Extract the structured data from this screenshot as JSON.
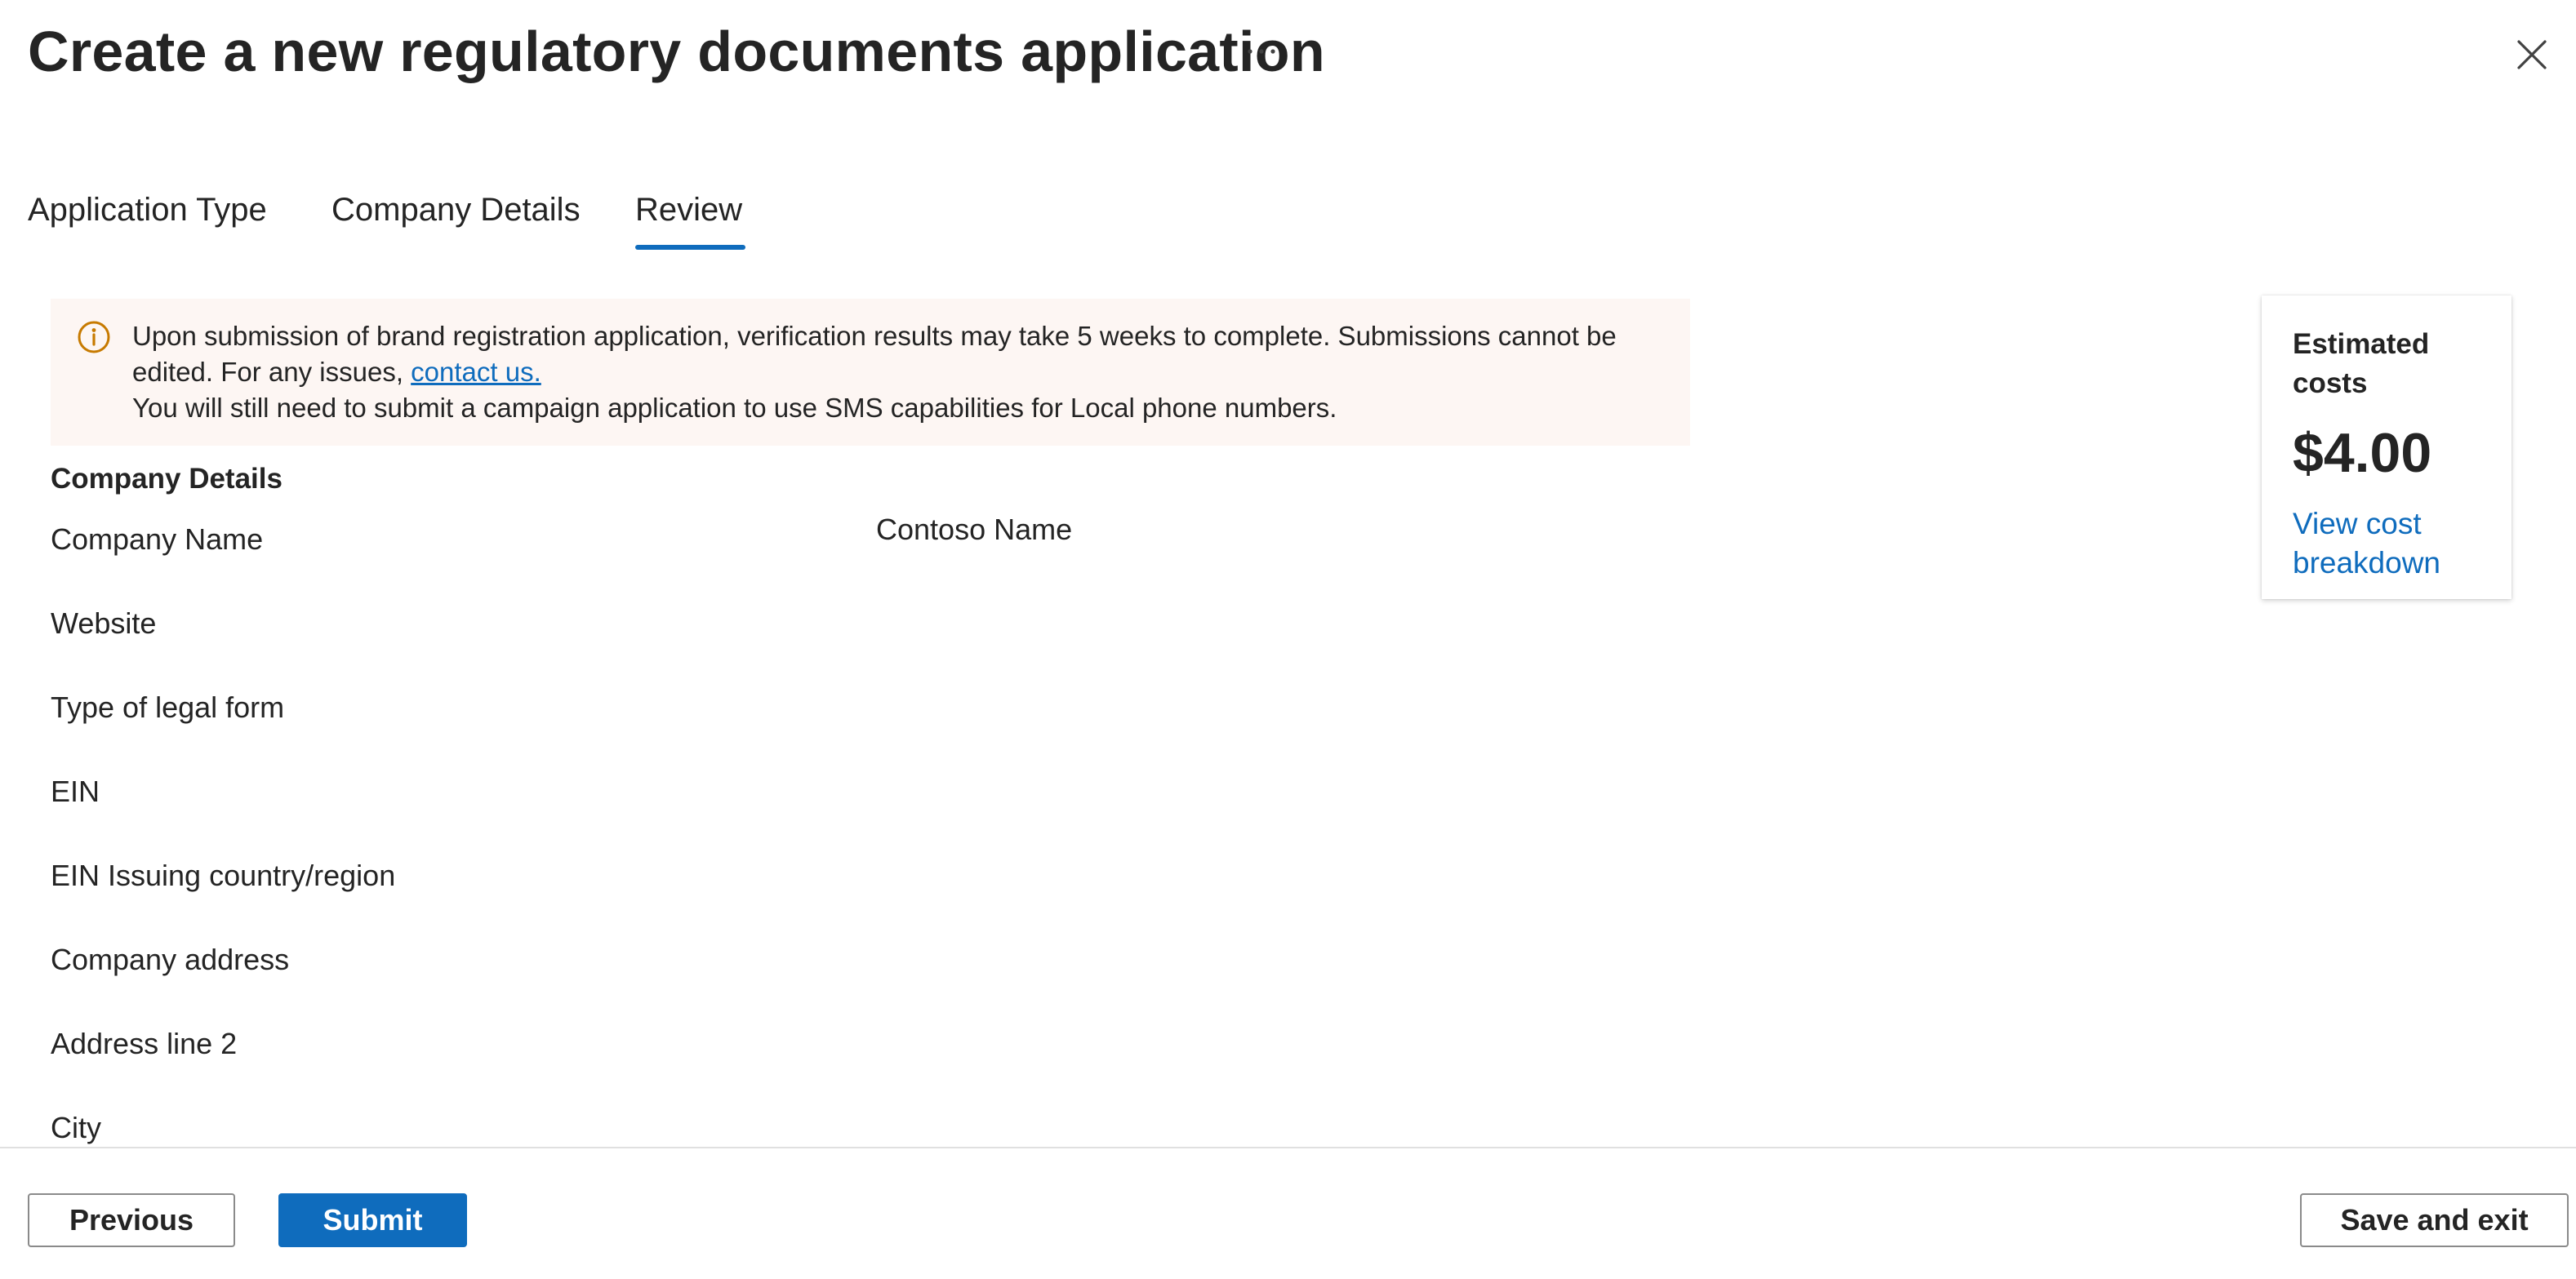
{
  "header": {
    "title": "Create a new regulatory documents application",
    "more_icon": "more-horizontal-icon",
    "close_icon": "close-icon"
  },
  "tabs": [
    {
      "label": "Application Type",
      "active": false
    },
    {
      "label": "Company Details",
      "active": false
    },
    {
      "label": "Review",
      "active": true
    }
  ],
  "banner": {
    "icon": "info-icon",
    "line1_before_link": "Upon submission of brand registration application, verification results may take 5 weeks to complete. Submissions cannot be edited. For any issues, ",
    "link": "contact us.",
    "line2": "You will still need to submit a campaign application to use SMS capabilities for Local phone numbers.",
    "background_color": "#fdf6f3",
    "icon_color": "#c77a00"
  },
  "company_details": {
    "section_title": "Company Details",
    "rows": [
      {
        "label": "Company Name",
        "value": "Contoso Name"
      },
      {
        "label": "Website",
        "value": ""
      },
      {
        "label": "Type of legal form",
        "value": ""
      },
      {
        "label": "EIN",
        "value": ""
      },
      {
        "label": "EIN Issuing country/region",
        "value": ""
      },
      {
        "label": "Company address",
        "value": ""
      },
      {
        "label": "Address line 2",
        "value": ""
      },
      {
        "label": "City",
        "value": ""
      }
    ]
  },
  "cost_card": {
    "title": "Estimated costs",
    "amount": "$4.00",
    "link": "View cost breakdown"
  },
  "footer": {
    "previous_label": "Previous",
    "submit_label": "Submit",
    "save_exit_label": "Save and exit"
  },
  "colors": {
    "accent": "#0f6cbd",
    "text": "#242424"
  }
}
